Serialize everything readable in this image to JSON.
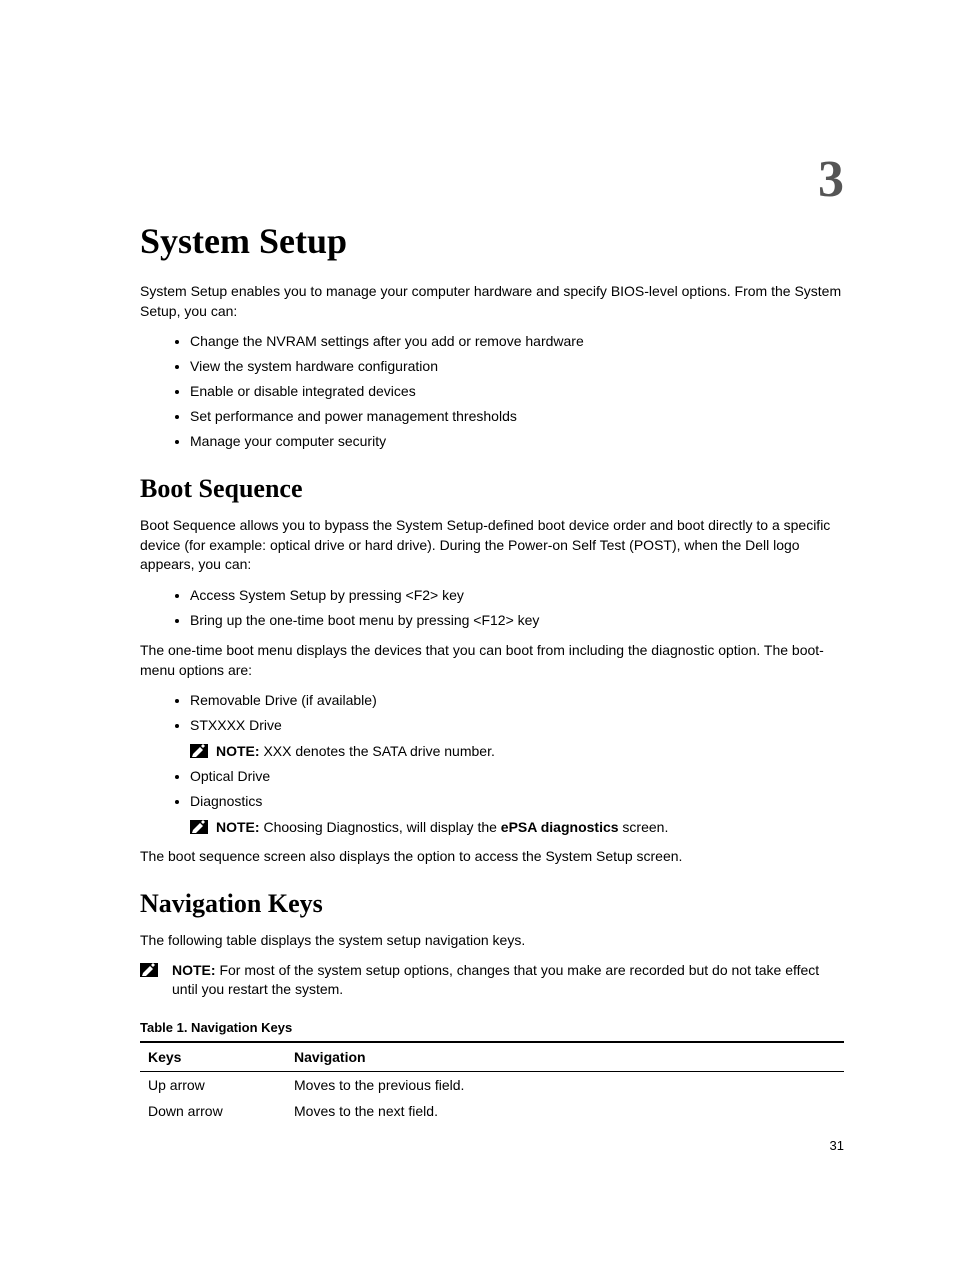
{
  "chapter_number": "3",
  "title": "System Setup",
  "intro": "System Setup enables you to manage your computer hardware and specify BIOS-level options. From the System Setup, you can:",
  "intro_bullets": [
    "Change the NVRAM settings after you add or remove hardware",
    "View the system hardware configuration",
    "Enable or disable integrated devices",
    "Set performance and power management thresholds",
    "Manage your computer security"
  ],
  "section_boot": {
    "heading": "Boot Sequence",
    "para1": "Boot Sequence allows you to bypass the System Setup-defined boot device order and boot directly to a specific device (for example: optical drive or hard drive). During the Power-on Self Test (POST), when the Dell logo appears, you can:",
    "bullets1": [
      "Access System Setup by pressing <F2> key",
      "Bring up the one-time boot menu by pressing <F12> key"
    ],
    "para2": "The one-time boot menu displays the devices that you can boot from including the diagnostic option. The boot-menu options are:",
    "bullet_removable": "Removable Drive (if available)",
    "bullet_stxxxx": "STXXXX Drive",
    "note1_label": "NOTE:",
    "note1_text": " XXX denotes the SATA drive number.",
    "bullet_optical": "Optical Drive",
    "bullet_diagnostics": "Diagnostics",
    "note2_label": "NOTE:",
    "note2_pre": " Choosing Diagnostics, will display the ",
    "note2_bold": "ePSA diagnostics",
    "note2_post": " screen.",
    "para3": "The boot sequence screen also displays the option to access the System Setup screen."
  },
  "section_nav": {
    "heading": "Navigation Keys",
    "para1": "The following table displays the system setup navigation keys.",
    "note_label": "NOTE:",
    "note_text": " For most of the system setup options, changes that you make are recorded but do not take effect until you restart the system.",
    "table_caption": "Table 1. Navigation Keys",
    "th_keys": "Keys",
    "th_nav": "Navigation",
    "rows": [
      {
        "keys": "Up arrow",
        "nav": "Moves to the previous field."
      },
      {
        "keys": "Down arrow",
        "nav": "Moves to the next field."
      }
    ]
  },
  "page_number": "31"
}
